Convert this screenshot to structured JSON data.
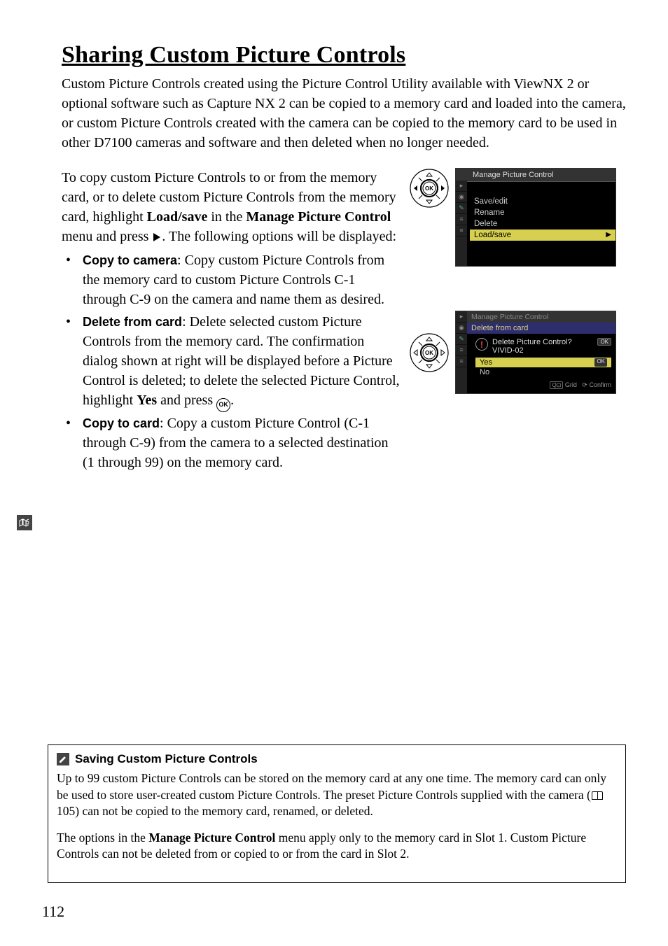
{
  "heading": "Sharing Custom Picture Controls",
  "intro": "Custom Picture Controls created using the Picture Control Utility available with ViewNX 2 or optional software such as Capture NX 2 can be copied to a memory card and loaded into the camera, or custom Picture Controls created with the camera can be copied to the memory card to be used in other D7100 cameras and software and then deleted when no longer needed.",
  "para2_pre": "To copy custom Picture Controls to or from the memory card, or to delete custom Picture Controls from the memory card, highlight ",
  "para2_bold1": "Load/save",
  "para2_mid": " in the ",
  "para2_bold2": "Manage Picture Control",
  "para2_post": " menu and press ",
  "para2_end": ".  The following options will be displayed:",
  "bullets": {
    "b1": {
      "lead": "Copy to camera",
      "rest": ": Copy custom Picture Controls from the memory card to custom Picture Controls C-1 through C-9 on the camera and name them as desired."
    },
    "b2": {
      "lead": "Delete from card",
      "rest_pre": ": Delete selected custom Picture Controls from the memory card.  The confirmation dialog shown at right will be displayed before a Picture Control is deleted; to delete the selected Picture Control, highlight ",
      "yes": "Yes",
      "rest_post": " and press "
    },
    "b3": {
      "lead": "Copy to card",
      "rest": ": Copy a custom Picture Control (C-1 through C-9) from the camera to a selected destination (1 through 99) on the memory card."
    }
  },
  "menu1": {
    "title": "Manage Picture Control",
    "items": [
      "Save/edit",
      "Rename",
      "Delete",
      "Load/save"
    ]
  },
  "menu2": {
    "title": "Manage Picture Control",
    "subtitle": "Delete from card",
    "question": "Delete Picture Control?",
    "name": "VIVID-02",
    "yes": "Yes",
    "no": "No",
    "footer_grid": "Grid",
    "footer_confirm": "Confirm",
    "ok": "OK"
  },
  "note": {
    "title": "Saving Custom Picture Controls",
    "p1_pre": "Up to 99 custom Picture Controls can be stored on the memory card at any one time.  The memory card can only be used to store user-created custom Picture Controls.  The preset Picture Controls supplied with the camera (",
    "p1_ref": " 105) can not be copied to the memory card, renamed, or deleted.",
    "p2_pre": "The options in the ",
    "p2_bold": "Manage Picture Control",
    "p2_post": " menu apply only to the memory card in Slot 1. Custom Picture Controls can not be deleted from or copied to or from the card in Slot 2."
  },
  "page_number": "112",
  "ok_label": "OK"
}
